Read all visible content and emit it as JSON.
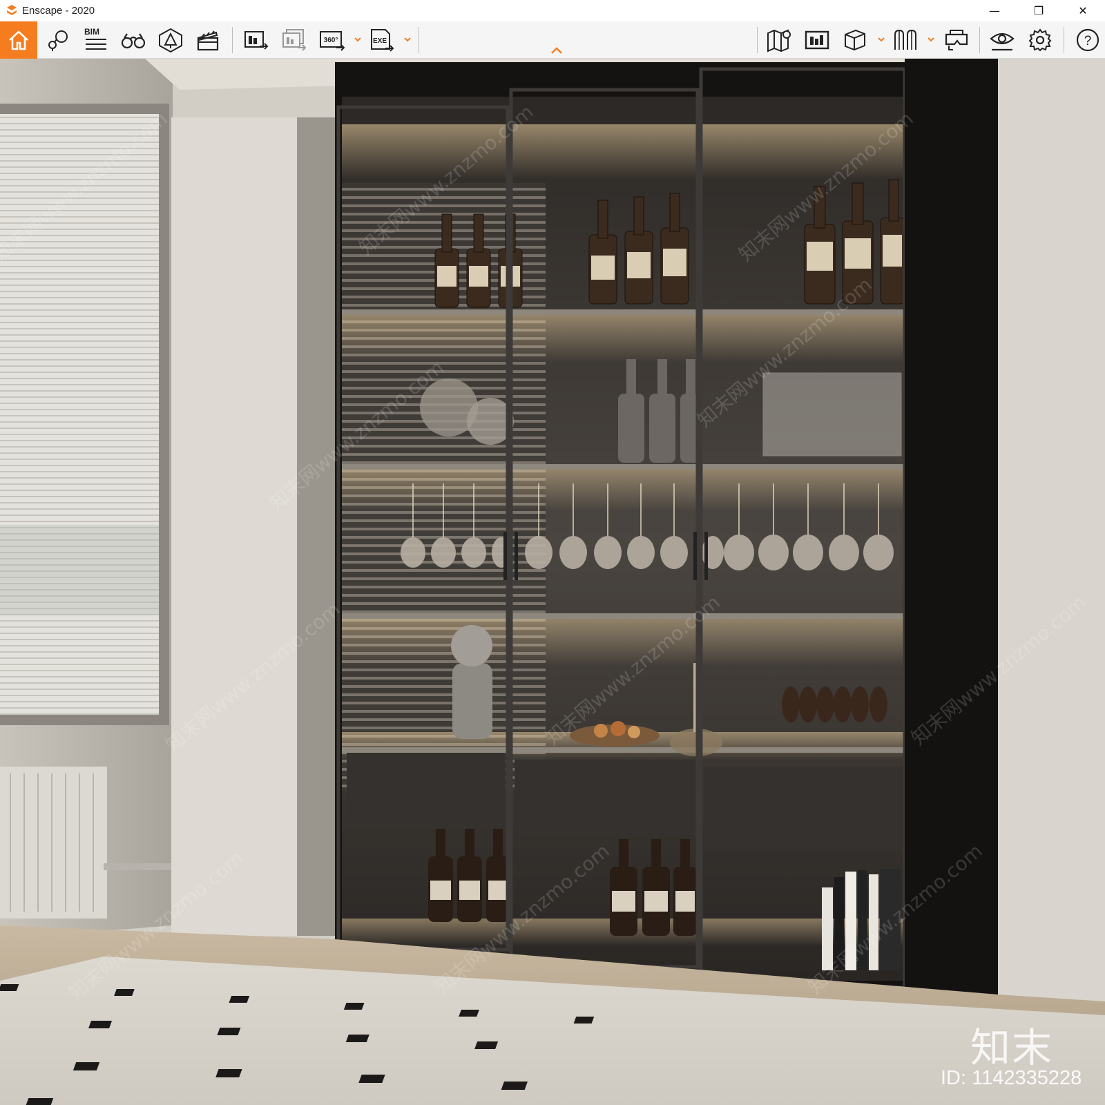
{
  "window": {
    "title": "Enscape - 2020",
    "controls": {
      "minimize": "—",
      "restore": "❐",
      "close": "✕"
    }
  },
  "toolbar": {
    "accent": "#f57c1f",
    "items": [
      {
        "name": "home",
        "icon": "home-icon",
        "active": true
      },
      {
        "name": "views",
        "icon": "view-pin-icon"
      },
      {
        "name": "bim",
        "icon": "bim-icon",
        "label": "BIM"
      },
      {
        "name": "walk",
        "icon": "binoculars-icon"
      },
      {
        "name": "assets",
        "icon": "asset-library-icon"
      },
      {
        "name": "video",
        "icon": "clapperboard-icon"
      },
      {
        "name": "render",
        "icon": "render-image-icon"
      },
      {
        "name": "batch",
        "icon": "batch-render-icon"
      },
      {
        "name": "panorama",
        "icon": "panorama-icon",
        "label": "360°"
      },
      {
        "name": "exe",
        "icon": "export-exe-icon",
        "label": "EXE"
      },
      {
        "name": "map",
        "icon": "map-icon"
      },
      {
        "name": "atmosphere",
        "icon": "site-context-icon"
      },
      {
        "name": "cube",
        "icon": "cube-icon"
      },
      {
        "name": "sync",
        "icon": "sync-views-icon"
      },
      {
        "name": "vr",
        "icon": "vr-headset-icon"
      },
      {
        "name": "visual",
        "icon": "eye-icon"
      },
      {
        "name": "settings",
        "icon": "gear-icon"
      },
      {
        "name": "help",
        "icon": "help-icon",
        "label": "?"
      }
    ]
  },
  "viewport": {
    "description_visible": false
  },
  "watermark": {
    "logo": "知末",
    "id": "ID: 1142335228",
    "tiled": "知末网www.znzmo.com"
  }
}
